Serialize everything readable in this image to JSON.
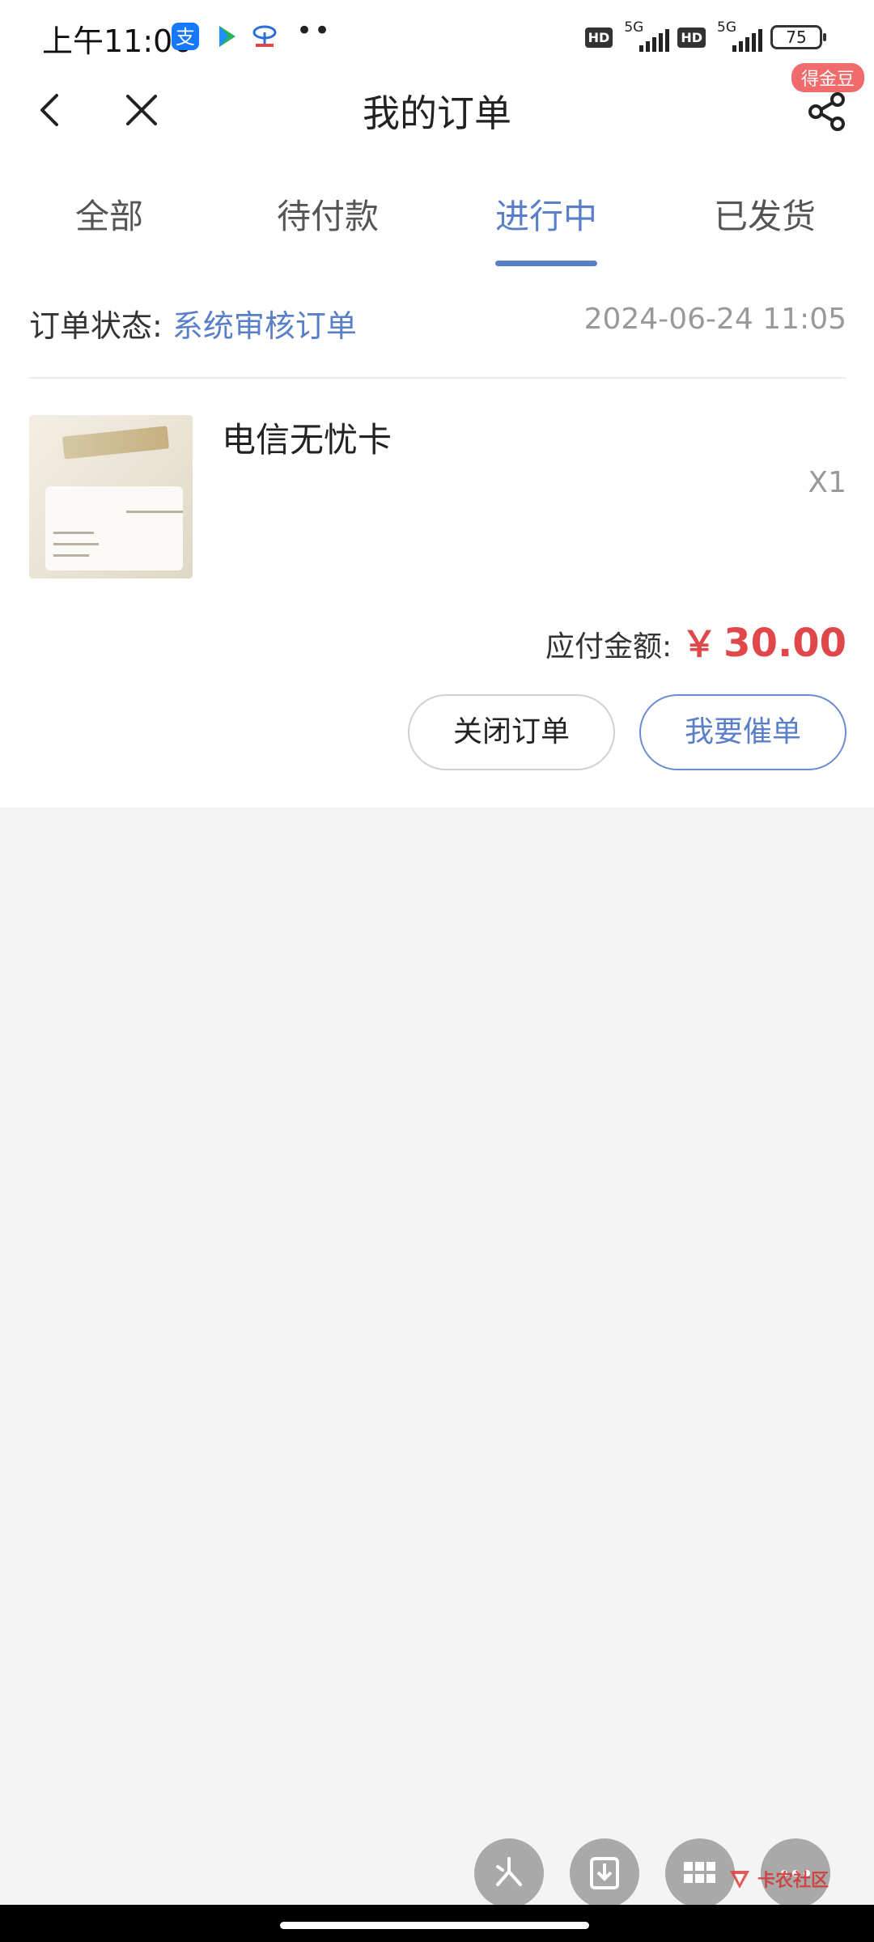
{
  "status_bar": {
    "time": "上午11:06",
    "dots": "••",
    "hd1": "HD",
    "net1": "5G",
    "hd2": "HD",
    "net2": "5G",
    "battery": "75"
  },
  "header": {
    "title": "我的订单",
    "badge": "得金豆"
  },
  "tabs": [
    {
      "label": "全部"
    },
    {
      "label": "待付款"
    },
    {
      "label": "进行中",
      "active": true
    },
    {
      "label": "已发货"
    }
  ],
  "order": {
    "status_label": "订单状态: ",
    "status_value": "系统审核订单",
    "date": "2024-06-24 11:05",
    "product_name": "电信无忧卡",
    "quantity": "X1",
    "amount_label": "应付金额:",
    "currency": "￥",
    "amount": "30.00",
    "close_button": "关闭订单",
    "urge_button": "我要催单"
  },
  "watermark": {
    "text": "卡农社区"
  },
  "colors": {
    "accent": "#5a7fc9",
    "price": "#e0474a",
    "badge": "#f06b6b",
    "background": "#f4f4f4"
  },
  "icons": [
    "back-icon",
    "close-icon",
    "share-icon",
    "alipay-icon",
    "video-app-icon",
    "telecom-icon",
    "sparkle-icon",
    "download-icon",
    "grid-icon",
    "more-icon"
  ]
}
